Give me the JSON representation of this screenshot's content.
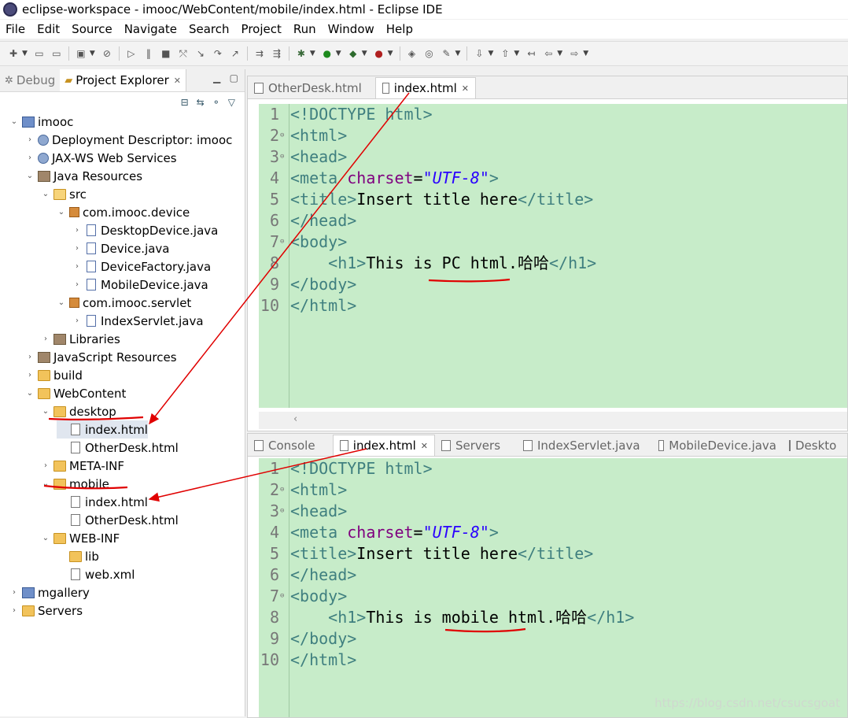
{
  "window": {
    "title": "eclipse-workspace - imooc/WebContent/mobile/index.html - Eclipse IDE"
  },
  "menu": [
    "File",
    "Edit",
    "Source",
    "Navigate",
    "Search",
    "Project",
    "Run",
    "Window",
    "Help"
  ],
  "left_panel": {
    "tabs": [
      {
        "label": "Debug",
        "icon": "bug-icon"
      },
      {
        "label": "Project Explorer",
        "icon": "folder-icon"
      }
    ]
  },
  "tree": [
    {
      "label": "imooc",
      "icon": "project-icon",
      "twisty": "open"
    },
    {
      "label": "Deployment Descriptor: imooc",
      "icon": "descriptor-icon",
      "twisty": "closed"
    },
    {
      "label": "JAX-WS Web Services",
      "icon": "webservice-icon",
      "twisty": "closed"
    },
    {
      "label": "Java Resources",
      "icon": "java-resources-icon",
      "twisty": "open"
    },
    {
      "label": "src",
      "icon": "source-folder-icon",
      "twisty": "open"
    },
    {
      "label": "com.imooc.device",
      "icon": "package-icon",
      "twisty": "open"
    },
    {
      "label": "DesktopDevice.java",
      "icon": "java-file-icon",
      "twisty": "closed"
    },
    {
      "label": "Device.java",
      "icon": "java-file-icon",
      "twisty": "closed"
    },
    {
      "label": "DeviceFactory.java",
      "icon": "java-file-icon",
      "twisty": "closed"
    },
    {
      "label": "MobileDevice.java",
      "icon": "java-file-icon",
      "twisty": "closed"
    },
    {
      "label": "com.imooc.servlet",
      "icon": "package-icon",
      "twisty": "open"
    },
    {
      "label": "IndexServlet.java",
      "icon": "java-file-icon",
      "twisty": "closed"
    },
    {
      "label": "Libraries",
      "icon": "library-icon",
      "twisty": "closed"
    },
    {
      "label": "JavaScript Resources",
      "icon": "js-resources-icon",
      "twisty": "closed"
    },
    {
      "label": "build",
      "icon": "folder-icon",
      "twisty": "closed"
    },
    {
      "label": "WebContent",
      "icon": "folder-icon",
      "twisty": "open"
    },
    {
      "label": "desktop",
      "icon": "folder-icon",
      "twisty": "open"
    },
    {
      "label": "index.html",
      "icon": "html-file-icon",
      "twisty": "none",
      "selected": true
    },
    {
      "label": "OtherDesk.html",
      "icon": "html-file-icon",
      "twisty": "none"
    },
    {
      "label": "META-INF",
      "icon": "folder-icon",
      "twisty": "closed"
    },
    {
      "label": "mobile",
      "icon": "folder-icon",
      "twisty": "open"
    },
    {
      "label": "index.html",
      "icon": "html-file-icon",
      "twisty": "none"
    },
    {
      "label": "OtherDesk.html",
      "icon": "html-file-icon",
      "twisty": "none"
    },
    {
      "label": "WEB-INF",
      "icon": "folder-icon",
      "twisty": "open"
    },
    {
      "label": "lib",
      "icon": "folder-icon",
      "twisty": "none"
    },
    {
      "label": "web.xml",
      "icon": "xml-file-icon",
      "twisty": "none"
    },
    {
      "label": "mgallery",
      "icon": "project-icon",
      "twisty": "closed"
    },
    {
      "label": "Servers",
      "icon": "folder-icon",
      "twisty": "closed"
    }
  ],
  "editor_top": {
    "tabs": [
      {
        "label": "OtherDesk.html",
        "active": false
      },
      {
        "label": "index.html",
        "active": true
      }
    ],
    "lines": [
      "<!DOCTYPE html>",
      "<html>",
      "<head>",
      "<meta charset=\"UTF-8\">",
      "<title>Insert title here</title>",
      "</head>",
      "<body>",
      "    <h1>This is PC html.哈哈</h1>",
      "</body>",
      "</html>"
    ]
  },
  "editor_bottom": {
    "tabs": [
      {
        "label": "Console",
        "active": false
      },
      {
        "label": "index.html",
        "active": true
      },
      {
        "label": "Servers",
        "active": false
      },
      {
        "label": "IndexServlet.java",
        "active": false
      },
      {
        "label": "MobileDevice.java",
        "active": false
      },
      {
        "label": "Deskto",
        "active": false
      }
    ],
    "lines": [
      "<!DOCTYPE html>",
      "<html>",
      "<head>",
      "<meta charset=\"UTF-8\">",
      "<title>Insert title here</title>",
      "</head>",
      "<body>",
      "    <h1>This is mobile html.哈哈</h1>",
      "</body>",
      "</html>"
    ]
  },
  "watermark": "https://blog.csdn.net/csucsgoat",
  "colors": {
    "editor_bg": "#c7ecc9",
    "annotation": "#e00000",
    "tag": "#3f7f7f",
    "attr": "#7f007f",
    "string": "#2a00ff"
  }
}
